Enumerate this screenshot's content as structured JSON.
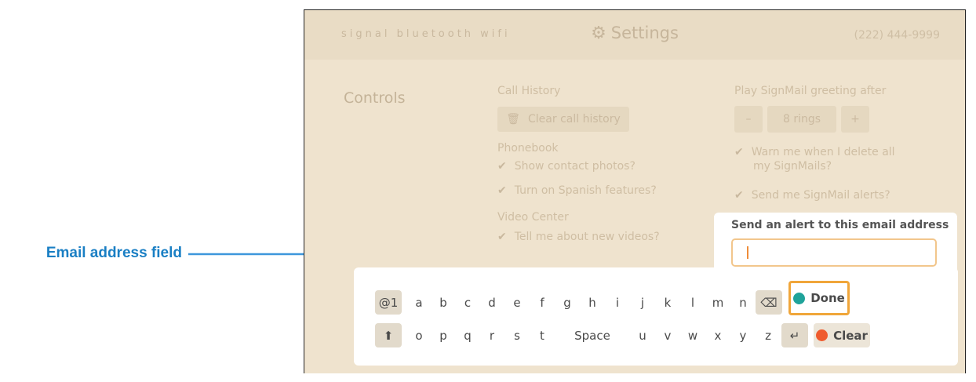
{
  "callout": {
    "label": "Email address field"
  },
  "header": {
    "status_icons": "signal  bluetooth  wifi",
    "title": "Settings",
    "phone": "(222) 444-9999"
  },
  "section": {
    "title": "Controls"
  },
  "call_history": {
    "heading": "Call History",
    "clear_button": "Clear call history"
  },
  "phonebook": {
    "heading": "Phonebook",
    "opt1": "Show contact photos?",
    "opt2": "Turn on Spanish features?"
  },
  "video_center": {
    "heading": "Video Center",
    "opt1": "Tell me about new videos?"
  },
  "signmail": {
    "heading": "Play SignMail greeting after",
    "minus": "–",
    "rings": "8 rings",
    "plus": "+",
    "warn_line1": "Warn me when I delete all",
    "warn_line2": "my SignMails?",
    "alerts": "Send me SignMail alerts?"
  },
  "email_popup": {
    "label": "Send an alert to this email address",
    "value": ""
  },
  "keyboard": {
    "row1": [
      "@1",
      "a",
      "b",
      "c",
      "d",
      "e",
      "f",
      "g",
      "h",
      "i",
      "j",
      "k",
      "l",
      "m",
      "n"
    ],
    "row2": [
      "o",
      "p",
      "q",
      "r",
      "s",
      "t",
      "Space",
      "u",
      "v",
      "w",
      "x",
      "y",
      "z"
    ],
    "done_label": "Done",
    "clear_label": "Clear",
    "done_color": "#1fa39a",
    "clear_color": "#ef5b2e"
  },
  "colors": {
    "accent_orange": "#f0a63a",
    "callout_blue": "#1a7fc4"
  }
}
